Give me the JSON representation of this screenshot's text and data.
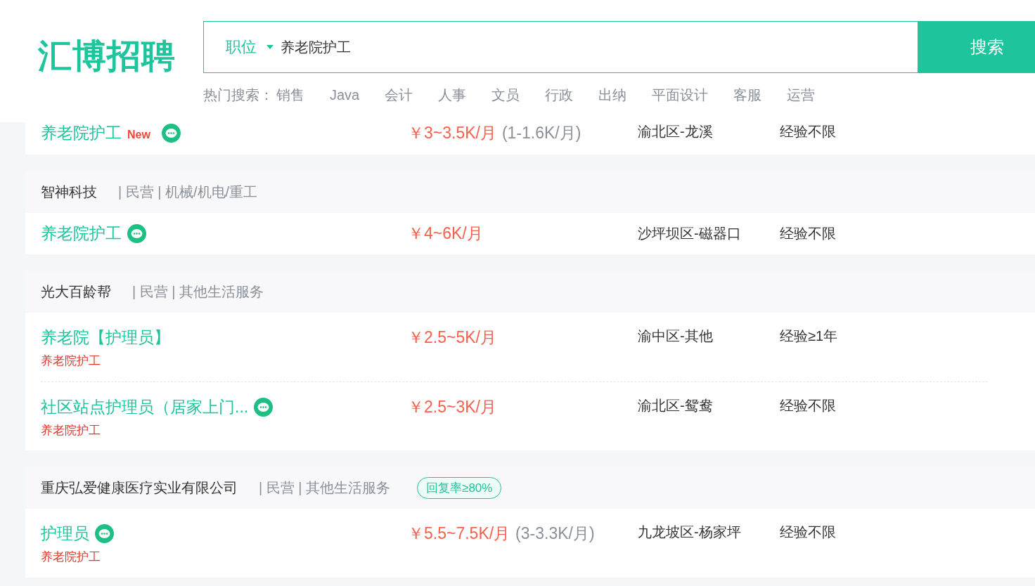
{
  "logo": "汇博招聘",
  "search": {
    "category": "职位",
    "value": "养老院护工",
    "button": "搜索"
  },
  "hot_search": {
    "label": "热门搜索：",
    "items": [
      "销售",
      "Java",
      "会计",
      "人事",
      "文员",
      "行政",
      "出纳",
      "平面设计",
      "客服",
      "运营"
    ]
  },
  "sections": [
    {
      "jobs": [
        {
          "title": "养老院护工",
          "new_badge": "New",
          "chat": true,
          "salary": "￥3~3.5K/月",
          "salary_note": "(1-1.6K/月)",
          "location": "渝北区-龙溪",
          "experience": "经验不限"
        }
      ]
    },
    {
      "company": {
        "name": "智神科技",
        "info": "| 民营 | 机械/机电/重工"
      },
      "jobs": [
        {
          "title": "养老院护工",
          "chat": true,
          "salary": "￥4~6K/月",
          "location": "沙坪坝区-磁器口",
          "experience": "经验不限"
        }
      ]
    },
    {
      "company": {
        "name": "光大百龄帮",
        "info": "| 民营 | 其他生活服务"
      },
      "jobs": [
        {
          "title": "养老院【护理员】",
          "chat": false,
          "tag": "养老院护工",
          "salary": "￥2.5~5K/月",
          "location": "渝中区-其他",
          "experience": "经验≥1年"
        },
        {
          "title": "社区站点护理员（居家上门...",
          "chat": true,
          "tag": "养老院护工",
          "salary": "￥2.5~3K/月",
          "location": "渝北区-鸳鸯",
          "experience": "经验不限"
        }
      ]
    },
    {
      "company": {
        "name": "重庆弘爱健康医疗实业有限公司",
        "info": "| 民营 | 其他生活服务",
        "badge": "回复率≥80%"
      },
      "jobs": [
        {
          "title": "护理员",
          "chat": true,
          "tag": "养老院护工",
          "salary": "￥5.5~7.5K/月",
          "salary_note": "(3-3.3K/月)",
          "location": "九龙坡区-杨家坪",
          "experience": "经验不限"
        }
      ]
    }
  ]
}
